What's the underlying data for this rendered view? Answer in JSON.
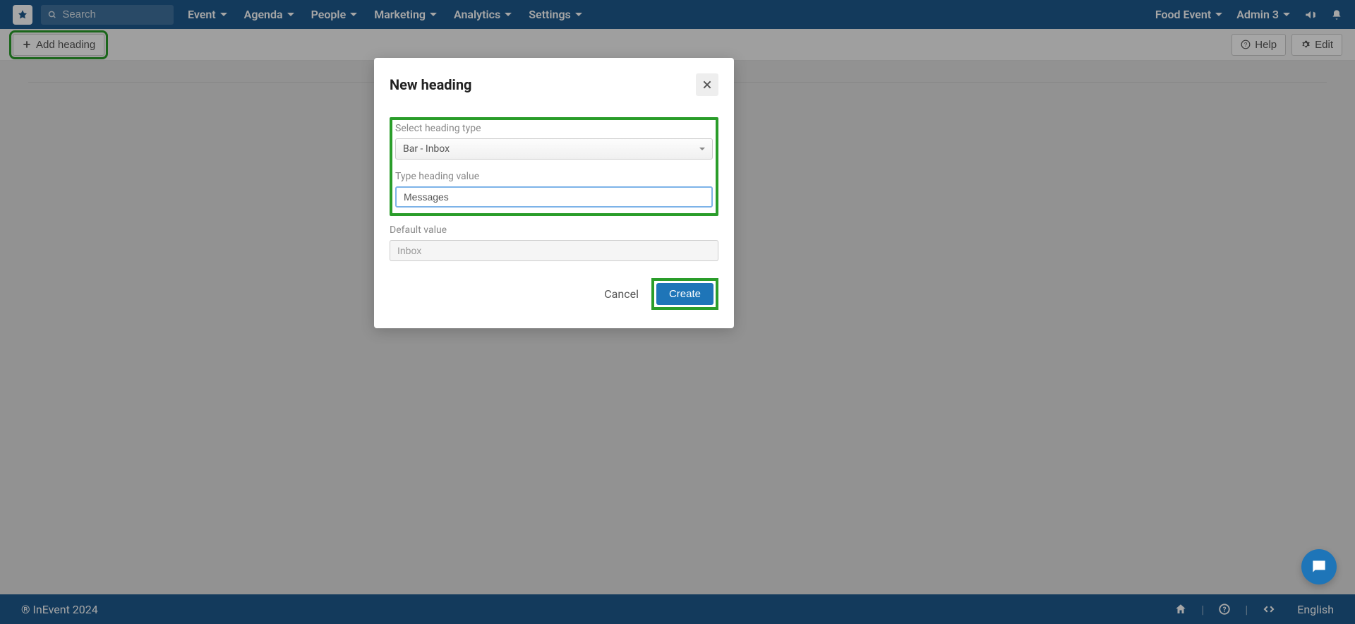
{
  "nav": {
    "search_placeholder": "Search",
    "items": [
      "Event",
      "Agenda",
      "People",
      "Marketing",
      "Analytics",
      "Settings"
    ],
    "event_name": "Food Event",
    "user_name": "Admin 3"
  },
  "toolbar": {
    "add_heading": "Add heading",
    "help": "Help",
    "edit": "Edit"
  },
  "modal": {
    "title": "New heading",
    "select_label": "Select heading type",
    "select_value": "Bar - Inbox",
    "value_label": "Type heading value",
    "value_input": "Messages",
    "default_label": "Default value",
    "default_value": "Inbox",
    "cancel": "Cancel",
    "create": "Create"
  },
  "footer": {
    "copyright": "® InEvent 2024",
    "language": "English"
  }
}
